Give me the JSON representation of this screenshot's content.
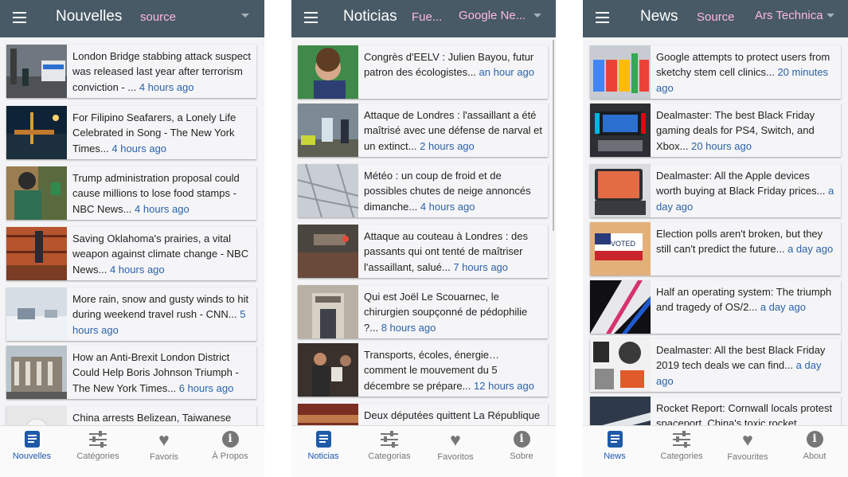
{
  "panels": [
    {
      "title": "Nouvelles",
      "source_label": "source",
      "source_value": "",
      "articles": [
        {
          "text": "London Bridge stabbing attack suspect was released last year after terrorism conviction - ...",
          "time": "4 hours ago"
        },
        {
          "text": "For Filipino Seafarers, a Lonely Life Celebrated in Song - The New York Times...",
          "time": "4 hours ago"
        },
        {
          "text": "Trump administration proposal could cause millions to lose food stamps - NBC News...",
          "time": "4 hours ago"
        },
        {
          "text": "Saving Oklahoma's prairies, a vital weapon against climate change - NBC News...",
          "time": "4 hours ago"
        },
        {
          "text": "More rain, snow and gusty winds to hit during weekend travel rush - CNN...",
          "time": "5 hours ago"
        },
        {
          "text": "How an Anti-Brexit London District Could Help Boris Johnson Triumph - The New York Times...",
          "time": "6 hours ago"
        },
        {
          "text": "China arrests Belizean, Taiwanese",
          "time": ""
        }
      ],
      "nav": [
        "Nouvelles",
        "Catégories",
        "Favoris",
        "À Propos"
      ]
    },
    {
      "title": "Noticias",
      "source_label": "Fue...",
      "source_value": "Google Ne...",
      "articles": [
        {
          "text": "Congrès d'EELV : Julien Bayou, futur patron des écologistes...",
          "time": "an hour ago"
        },
        {
          "text": "Attaque de Londres : l'assaillant a été maîtrisé avec une défense de narval et un extinct...",
          "time": "2 hours ago"
        },
        {
          "text": "Météo : un coup de froid et de possibles chutes de neige annoncés dimanche...",
          "time": "4 hours ago"
        },
        {
          "text": "Attaque au couteau à Londres : des passants qui ont tenté de maîtriser l'assaillant, salué...",
          "time": "7 hours ago"
        },
        {
          "text": "Qui est Joël Le Scouarnec, le chirurgien soupçonné de pédophilie ?...",
          "time": "8 hours ago"
        },
        {
          "text": "Transports, écoles, énergie… comment le mouvement du 5 décembre se prépare...",
          "time": "12 hours ago"
        },
        {
          "text": "Deux députées quittent La République",
          "time": ""
        }
      ],
      "nav": [
        "Noticias",
        "Categorias",
        "Favoritos",
        "Sobre"
      ]
    },
    {
      "title": "News",
      "source_label": "Source",
      "source_value": "Ars Technica",
      "articles": [
        {
          "text": "Google attempts to protect users from sketchy stem cell clinics...",
          "time": "20 minutes ago"
        },
        {
          "text": "Dealmaster: The best Black Friday gaming deals for PS4, Switch, and Xbox...",
          "time": "20 hours ago"
        },
        {
          "text": "Dealmaster: All the Apple devices worth buying at Black Friday prices...",
          "time": "a day ago"
        },
        {
          "text": "Election polls aren't broken, but they still can't predict the future...",
          "time": "a day ago"
        },
        {
          "text": "Half an operating system: The triumph and tragedy of OS/2...",
          "time": "a day ago"
        },
        {
          "text": "Dealmaster: All the best Black Friday 2019 tech deals we can find...",
          "time": "a day ago"
        },
        {
          "text": "Rocket Report: Cornwall locals protest spaceport, China's toxic rocket",
          "time": ""
        }
      ],
      "nav": [
        "News",
        "Categories",
        "Favourites",
        "About"
      ]
    }
  ],
  "icons": {
    "nav": [
      "news-icon",
      "sliders-icon",
      "heart-icon",
      "info-icon"
    ],
    "menu": "hamburger-menu-icon",
    "dropdown": "chevron-down-icon"
  },
  "colors": {
    "appbar": "#475a66",
    "accent": "#ffb8e0",
    "link_time": "#2b62a8",
    "nav_active": "#1e5aa8",
    "nav_inactive": "#777777"
  }
}
